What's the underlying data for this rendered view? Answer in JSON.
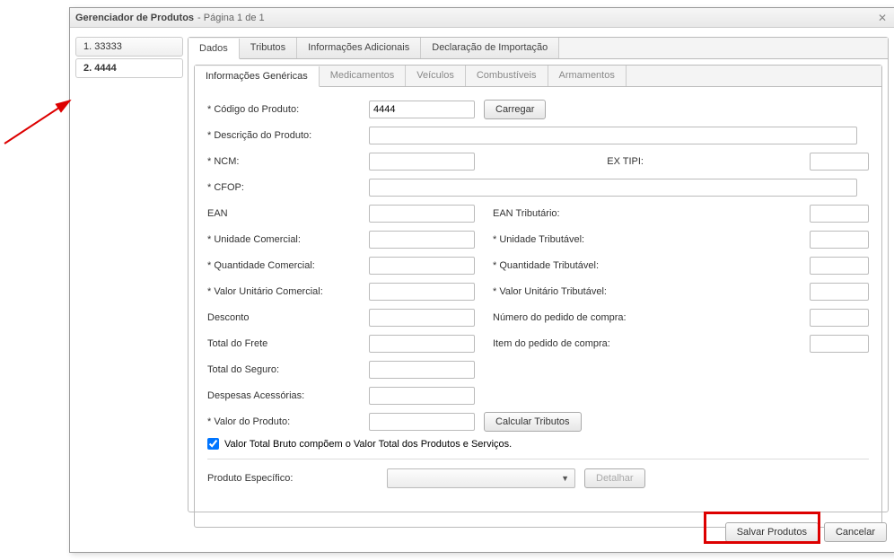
{
  "window": {
    "title": "Gerenciador de Produtos",
    "subtitle": "- Página 1 de 1"
  },
  "sidebar": {
    "items": [
      {
        "label": "1. 33333"
      },
      {
        "label": "2. 4444"
      }
    ]
  },
  "tabs": {
    "main": [
      "Dados",
      "Tributos",
      "Informações Adicionais",
      "Declaração de Importação"
    ],
    "inner": [
      "Informações Genéricas",
      "Medicamentos",
      "Veículos",
      "Combustíveis",
      "Armamentos"
    ]
  },
  "form": {
    "codigo_label": "* Código do Produto:",
    "codigo_value": "4444",
    "carregar": "Carregar",
    "descricao_label": "* Descrição do Produto:",
    "ncm_label": "* NCM:",
    "ex_tipi_label": "EX TIPI:",
    "cfop_label": "* CFOP:",
    "ean_label": "EAN",
    "ean_trib_label": "EAN Tributário:",
    "un_com_label": "* Unidade Comercial:",
    "un_trib_label": "* Unidade Tributável:",
    "qt_com_label": "* Quantidade Comercial:",
    "qt_trib_label": "* Quantidade Tributável:",
    "vl_unit_com_label": "* Valor Unitário Comercial:",
    "vl_unit_trib_label": "* Valor Unitário Tributável:",
    "desconto_label": "Desconto",
    "num_pedido_label": "Número do pedido de compra:",
    "frete_label": "Total do Frete",
    "item_pedido_label": "Item do pedido de compra:",
    "seguro_label": "Total do Seguro:",
    "despesas_label": "Despesas Acessórias:",
    "valor_produto_label": "* Valor do Produto:",
    "calcular": "Calcular Tributos",
    "check_label": "Valor Total Bruto compõem o Valor Total dos Produtos e Serviços.",
    "prod_especifico_label": "Produto Específico:",
    "detalhar": "Detalhar"
  },
  "footer": {
    "save": "Salvar Produtos",
    "cancel": "Cancelar"
  }
}
